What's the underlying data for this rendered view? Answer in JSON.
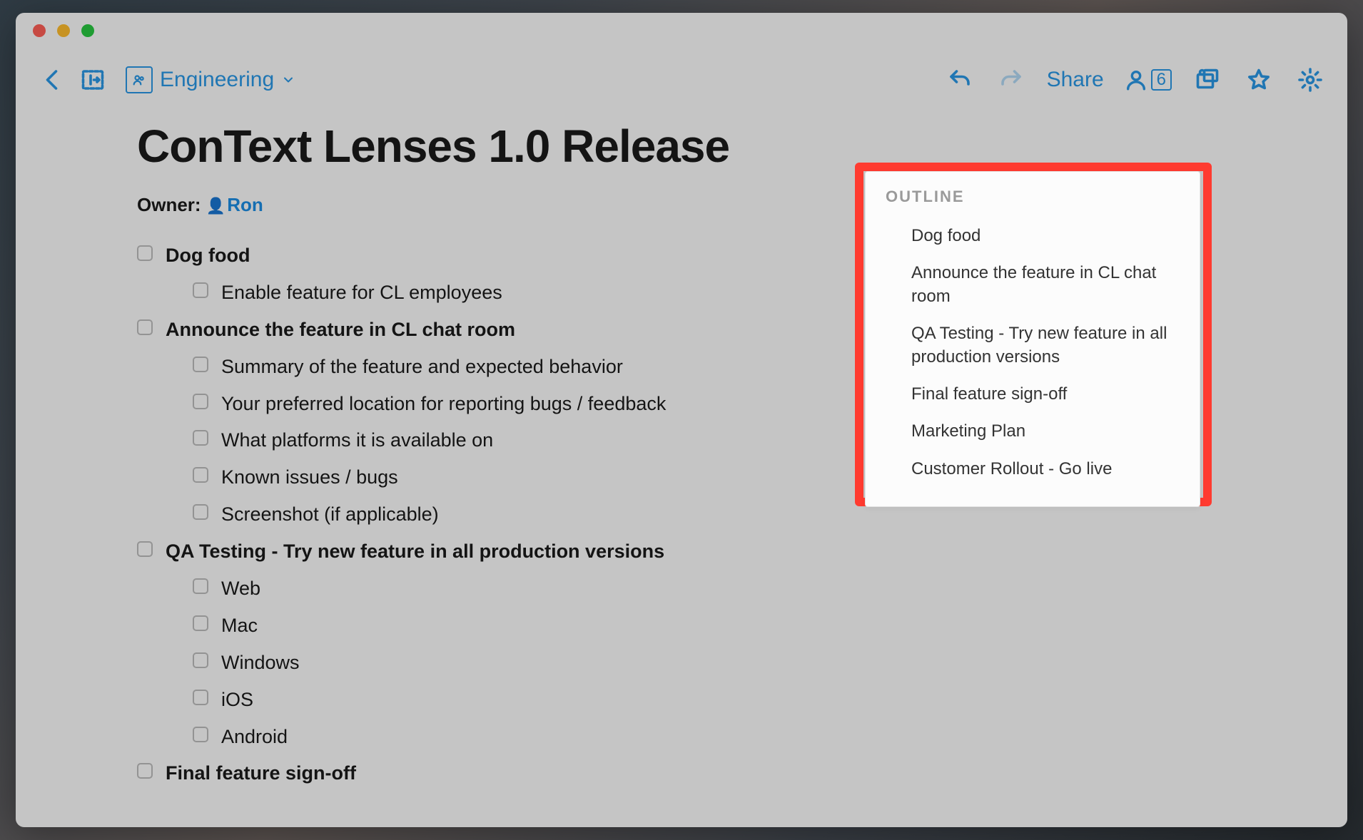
{
  "toolbar": {
    "breadcrumb_label": "Engineering",
    "share_label": "Share",
    "follower_count": "6"
  },
  "document": {
    "title": "ConText Lenses 1.0 Release",
    "owner_label": "Owner:",
    "owner_name": "Ron"
  },
  "checklist": [
    {
      "heading": true,
      "text": "Dog food",
      "children": [
        "Enable feature for CL employees"
      ]
    },
    {
      "heading": true,
      "text": "Announce the feature in CL chat room",
      "children": [
        "Summary of the feature and expected behavior",
        "Your preferred location for reporting bugs / feedback",
        "What platforms it is available on",
        "Known issues / bugs",
        "Screenshot (if applicable)"
      ]
    },
    {
      "heading": true,
      "text": "QA Testing - Try new feature in all production versions",
      "children": [
        "Web",
        "Mac",
        "Windows",
        "iOS",
        "Android"
      ]
    },
    {
      "heading": true,
      "text": "Final feature sign-off",
      "children": []
    }
  ],
  "outline": {
    "title": "OUTLINE",
    "items": [
      "Dog food",
      "Announce the feature in CL chat room",
      "QA Testing - Try new feature in all production versions",
      "Final feature sign-off",
      "Marketing Plan",
      "Customer Rollout - Go live"
    ]
  }
}
